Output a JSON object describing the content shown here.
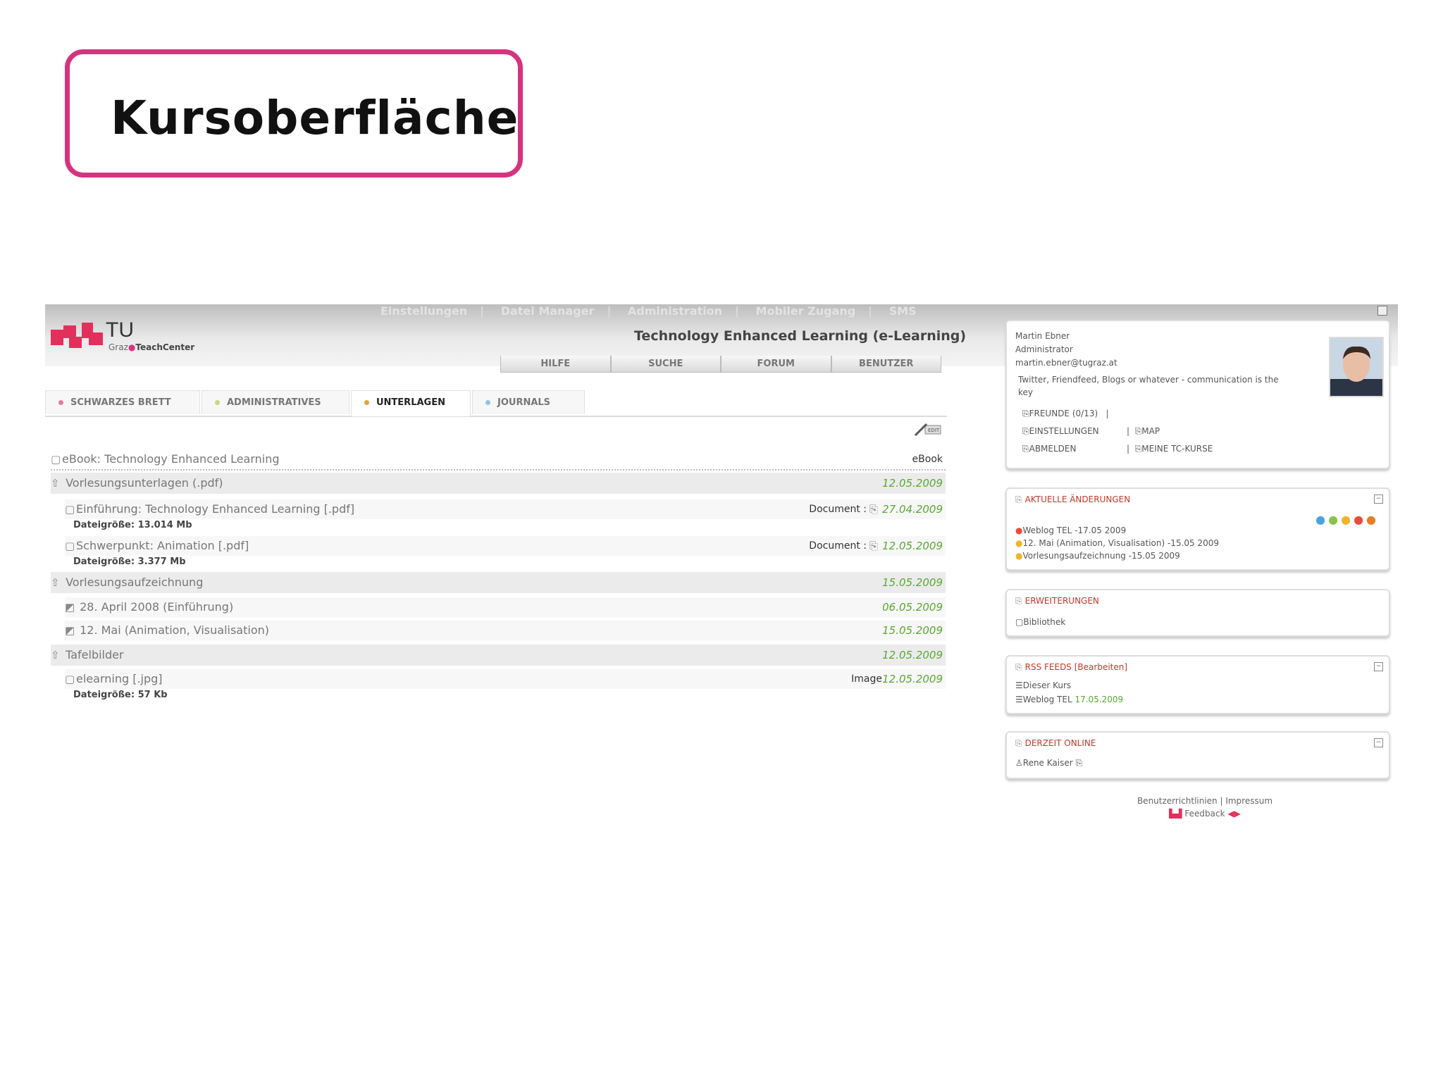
{
  "slide": {
    "title": "Kursoberfläche"
  },
  "top_nav": [
    "Einstellungen",
    "Datei Manager",
    "Administration",
    "Mobiler Zugang",
    "SMS"
  ],
  "logo": {
    "main": "TU",
    "sub_left": "Graz",
    "sub_right": "TeachCenter"
  },
  "course_title": "Technology Enhanced Learning (e-Learning)",
  "sub_nav": [
    "HILFE",
    "SUCHE",
    "FORUM",
    "BENUTZER"
  ],
  "tabs": [
    {
      "label": "SCHWARZES BRETT",
      "color": "#e57a9a"
    },
    {
      "label": "ADMINISTRATIVES",
      "color": "#c9d77a"
    },
    {
      "label": "UNTERLAGEN",
      "color": "#e5a72c"
    },
    {
      "label": "JOURNALS",
      "color": "#8fc3e6"
    }
  ],
  "content": {
    "ebook": {
      "title": "eBook: Technology Enhanced Learning",
      "type": "eBook"
    },
    "folders": [
      {
        "title": "Vorlesungsunterlagen (.pdf)",
        "date": "12.05.2009",
        "items": [
          {
            "title": "Einführung: Technology Enhanced Learning [.pdf]",
            "type": "Document :",
            "date": "27.04.2009",
            "size_label": "Dateigröße:",
            "size": "13.014 Mb"
          },
          {
            "title": "Schwerpunkt: Animation [.pdf]",
            "type": "Document :",
            "date": "12.05.2009",
            "size_label": "Dateigröße:",
            "size": "3.377 Mb"
          }
        ]
      },
      {
        "title": "Vorlesungsaufzeichnung",
        "date": "15.05.2009",
        "items": [
          {
            "title": "28. April 2008 (Einführung)",
            "date": "06.05.2009"
          },
          {
            "title": "12. Mai (Animation, Visualisation)",
            "date": "15.05.2009"
          }
        ]
      },
      {
        "title": "Tafelbilder",
        "date": "12.05.2009",
        "items": [
          {
            "title": "elearning [.jpg]",
            "type": "Image",
            "date": "12.05.2009",
            "size_label": "Dateigröße:",
            "size": "57 Kb"
          }
        ]
      }
    ]
  },
  "profile": {
    "name": "Martin Ebner",
    "role": "Administrator",
    "email": "martin.ebner@tugraz.at",
    "status": "Twitter, Friendfeed, Blogs or whatever - communication is the",
    "status_cont": "key",
    "links": [
      "FREUNDE (0/13)",
      "EINSTELLUNGEN",
      "MAP",
      "ABMELDEN",
      "MEINE TC-KURSE"
    ]
  },
  "panels": {
    "changes": {
      "title": "AKTUELLE ÄNDERUNGEN",
      "dots": [
        "#4aa3df",
        "#8bc34a",
        "#f0b429",
        "#e74c3c",
        "#e67e22"
      ],
      "items": [
        {
          "text": "Weblog TEL -17.05 2009",
          "color": "#e74c3c"
        },
        {
          "text": "12. Mai (Animation, Visualisation) -15.05 2009",
          "color": "#f0b429"
        },
        {
          "text": "Vorlesungsaufzeichnung -15.05 2009",
          "color": "#f0b429"
        }
      ]
    },
    "extensions": {
      "title": "ERWEITERUNGEN",
      "item": "Bibliothek"
    },
    "rss": {
      "title": "RSS FEEDS",
      "edit": "[Bearbeiten]",
      "item1": "Dieser Kurs",
      "item2": "Weblog TEL",
      "item2_date": "17.05.2009"
    },
    "online": {
      "title": "DERZEIT ONLINE",
      "user": "Rene Kaiser"
    }
  },
  "footer": {
    "links": "Benutzerrichtlinien | Impressum",
    "feedback": "Feedback"
  }
}
